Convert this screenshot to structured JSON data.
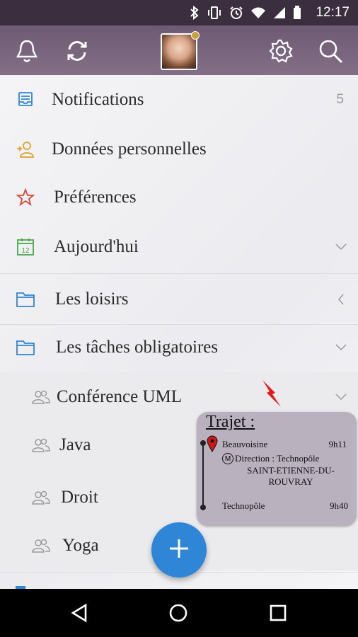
{
  "status_bar": {
    "time": "12:17"
  },
  "menu": {
    "items": [
      {
        "label": "Notifications",
        "count": "5",
        "icon": "inbox-icon"
      },
      {
        "label": "Données personnelles",
        "icon": "user-add-icon"
      },
      {
        "label": "Préférences",
        "icon": "star-icon"
      },
      {
        "label": "Aujourd'hui",
        "icon": "calendar-icon",
        "calendar_day": "12"
      },
      {
        "label": "Les loisirs",
        "icon": "folder-icon"
      },
      {
        "label": "Les tâches obligatoires",
        "icon": "folder-icon"
      }
    ],
    "subitems": [
      {
        "label": "Conférence UML",
        "icon": "group-icon"
      },
      {
        "label": "Java",
        "icon": "group-icon"
      },
      {
        "label": "Droit",
        "icon": "group-icon"
      },
      {
        "label": "Yoga",
        "icon": "group-icon"
      }
    ]
  },
  "popup": {
    "title": "Trajet :",
    "from_stop": "Beauvoisine",
    "from_time": "9h11",
    "metro_letter": "M",
    "direction": "Direction : Technopôle",
    "destination": "SAINT-ETIENNE-DU-ROUVRAY",
    "to_stop": "Technopôle",
    "to_time": "9h40"
  },
  "colors": {
    "accent_blue": "#2f86d6",
    "topbar": "#7a667e",
    "star_red": "#d9463b",
    "calendar_green": "#4aa64a",
    "user_orange": "#e0a030",
    "popup_bg": "#b9b1be"
  }
}
